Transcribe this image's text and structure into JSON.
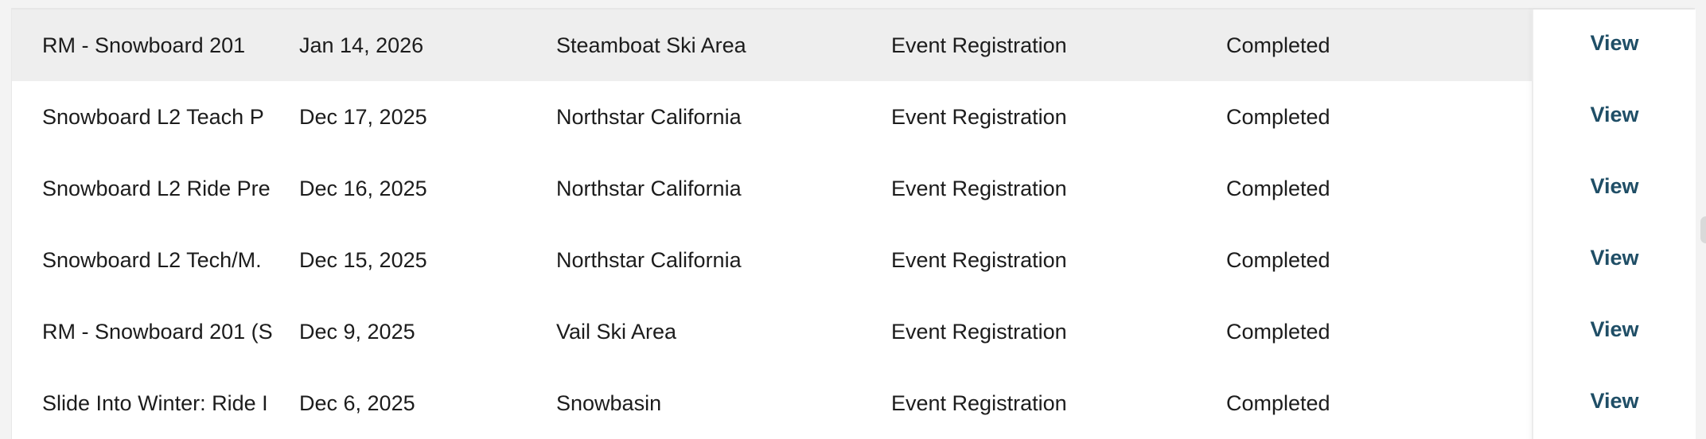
{
  "table": {
    "rows": [
      {
        "name": "RM - Snowboard 201",
        "date": "Jan 14, 2026",
        "location": "Steamboat Ski Area",
        "type": "Event Registration",
        "status": "Completed",
        "action": "View"
      },
      {
        "name": "Snowboard L2 Teach P",
        "date": "Dec 17, 2025",
        "location": "Northstar California",
        "type": "Event Registration",
        "status": "Completed",
        "action": "View"
      },
      {
        "name": "Snowboard L2 Ride Pre",
        "date": "Dec 16, 2025",
        "location": "Northstar California",
        "type": "Event Registration",
        "status": "Completed",
        "action": "View"
      },
      {
        "name": "Snowboard L2 Tech/M.",
        "date": "Dec 15, 2025",
        "location": "Northstar California",
        "type": "Event Registration",
        "status": "Completed",
        "action": "View"
      },
      {
        "name": "RM - Snowboard 201 (S",
        "date": "Dec 9, 2025",
        "location": "Vail Ski Area",
        "type": "Event Registration",
        "status": "Completed",
        "action": "View"
      },
      {
        "name": "Slide Into Winter: Ride I",
        "date": "Dec 6, 2025",
        "location": "Snowbasin",
        "type": "Event Registration",
        "status": "Completed",
        "action": "View"
      }
    ]
  },
  "colors": {
    "link": "#1f4e66",
    "hover_row": "#eeeeee",
    "text": "#1c1c1c"
  }
}
